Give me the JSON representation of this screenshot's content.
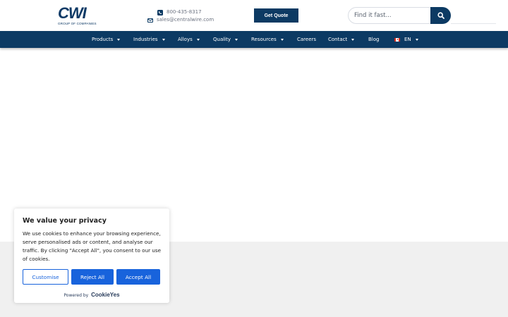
{
  "header": {
    "logo_text": "CWI",
    "logo_subtitle": "GROUP OF COMPANIES",
    "phone": "800-435-8317",
    "email": "sales@centralwire.com",
    "quote_button": "Get Quote",
    "search_placeholder": "Find it fast...",
    "brand_color": "#0c3a63"
  },
  "nav": {
    "items": [
      {
        "label": "Products",
        "has_dropdown": true
      },
      {
        "label": "Industries",
        "has_dropdown": true
      },
      {
        "label": "Alloys",
        "has_dropdown": true
      },
      {
        "label": "Quality",
        "has_dropdown": true
      },
      {
        "label": "Resources",
        "has_dropdown": true
      },
      {
        "label": "Careers",
        "has_dropdown": false
      },
      {
        "label": "Contact",
        "has_dropdown": true
      },
      {
        "label": "Blog",
        "has_dropdown": false
      }
    ],
    "language": "EN"
  },
  "cookie_banner": {
    "title": "We value your privacy",
    "body": "We use cookies to enhance your browsing experience, serve personalised ads or content, and analyse our traffic. By clicking \"Accept All\", you consent to our use of cookies.",
    "customise": "Customise",
    "reject": "Reject All",
    "accept": "Accept All",
    "powered_by": "Powered by",
    "powered_brand": "CookieYes",
    "accent_color": "#1863dc"
  }
}
